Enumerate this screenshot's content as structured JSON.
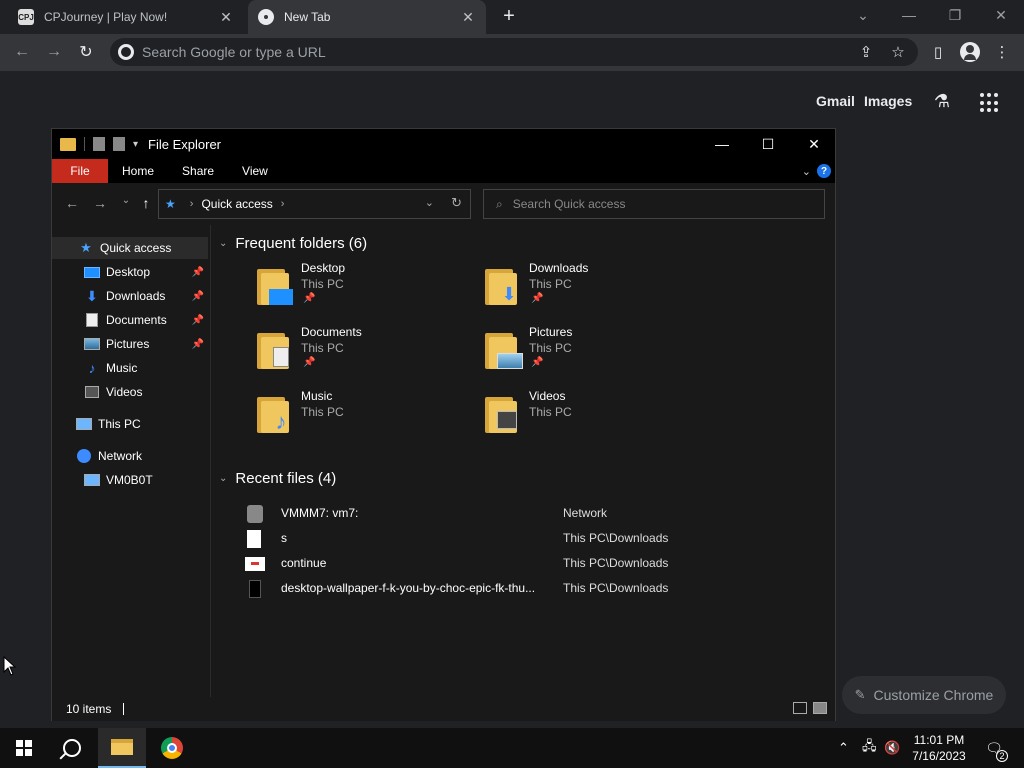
{
  "browser": {
    "tabs": [
      {
        "title": "CPJourney | Play Now!",
        "icon": "cpjourney-favicon"
      },
      {
        "title": "New Tab",
        "icon": "chrome-favicon"
      }
    ],
    "omnibox_placeholder": "Search Google or type a URL"
  },
  "ntp": {
    "links": [
      "Gmail",
      "Images"
    ],
    "customize_label": "Customize Chrome"
  },
  "explorer": {
    "title": "File Explorer",
    "ribbon_tabs": [
      "File",
      "Home",
      "Share",
      "View"
    ],
    "address_crumb": "Quick access",
    "search_placeholder": "Search Quick access",
    "nav": {
      "quick_access": "Quick access",
      "items": [
        "Desktop",
        "Downloads",
        "Documents",
        "Pictures",
        "Music",
        "Videos"
      ],
      "this_pc": "This PC",
      "network": "Network",
      "vm": "VM0B0T"
    },
    "frequent_header": "Frequent folders (6)",
    "frequent": [
      {
        "name": "Desktop",
        "location": "This PC",
        "pinned": true
      },
      {
        "name": "Downloads",
        "location": "This PC",
        "pinned": true
      },
      {
        "name": "Documents",
        "location": "This PC",
        "pinned": true
      },
      {
        "name": "Pictures",
        "location": "This PC",
        "pinned": true
      },
      {
        "name": "Music",
        "location": "This PC",
        "pinned": false
      },
      {
        "name": "Videos",
        "location": "This PC",
        "pinned": false
      }
    ],
    "recent_header": "Recent files (4)",
    "recent": [
      {
        "name": "VMMM7: vm7:",
        "location": "Network"
      },
      {
        "name": "s",
        "location": "This PC\\Downloads"
      },
      {
        "name": "continue",
        "location": "This PC\\Downloads"
      },
      {
        "name": "desktop-wallpaper-f-k-you-by-choc-epic-fk-thu...",
        "location": "This PC\\Downloads"
      }
    ],
    "status": "10 items"
  },
  "taskbar": {
    "time": "11:01 PM",
    "date": "7/16/2023",
    "notification_count": "2"
  }
}
